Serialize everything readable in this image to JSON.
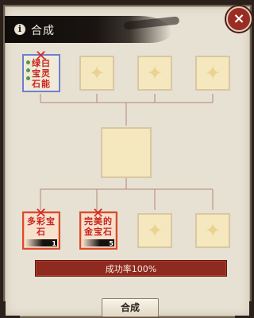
{
  "window": {
    "title": "合成",
    "close_label": "×"
  },
  "top_row": {
    "item": {
      "name": "绿白\n宝灵\n石能",
      "icon": "gem-sheet-icon"
    },
    "empty_slots": 3
  },
  "result_slot": {
    "label": ""
  },
  "bottom_row": {
    "items": [
      {
        "name": "多彩宝\n石",
        "count": "1"
      },
      {
        "name": "完美的\n金宝石",
        "count": "5"
      }
    ],
    "empty_slots": 2
  },
  "success_rate": {
    "text": "成功率100%",
    "value_percent": 100
  },
  "actions": {
    "craft_label": "合成"
  },
  "colors": {
    "panel_bg": "#e7e1d3",
    "slot_bg": "#f5e7be",
    "accent_red": "#8e2a20",
    "item_border_blue": "#6e7fd0",
    "item_border_red": "#d94a2a"
  }
}
